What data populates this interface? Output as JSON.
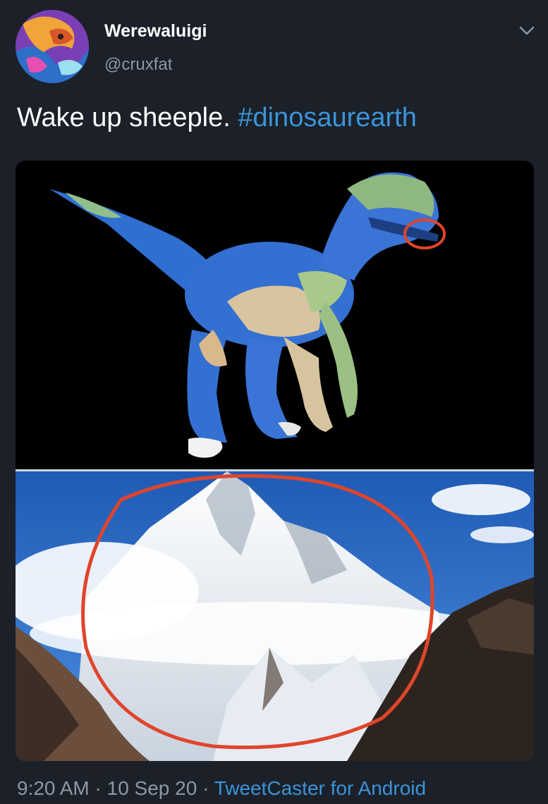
{
  "tweet": {
    "display_name": "Werewaluigi",
    "handle": "@cruxfat",
    "text": "Wake up sheeple. ",
    "hashtag": "#dinosaurearth",
    "time": "9:20 AM",
    "separator": " · ",
    "date": "10 Sep 20",
    "source": "TweetCaster for Android"
  },
  "icons": {
    "menu": "chevron-down-icon",
    "avatar": "avatar-illustration"
  },
  "colors": {
    "background": "#1b2029",
    "text": "#ffffff",
    "secondary_text": "#8b98a5",
    "link": "#3b94d9",
    "annotation_circle": "#e0452b"
  }
}
